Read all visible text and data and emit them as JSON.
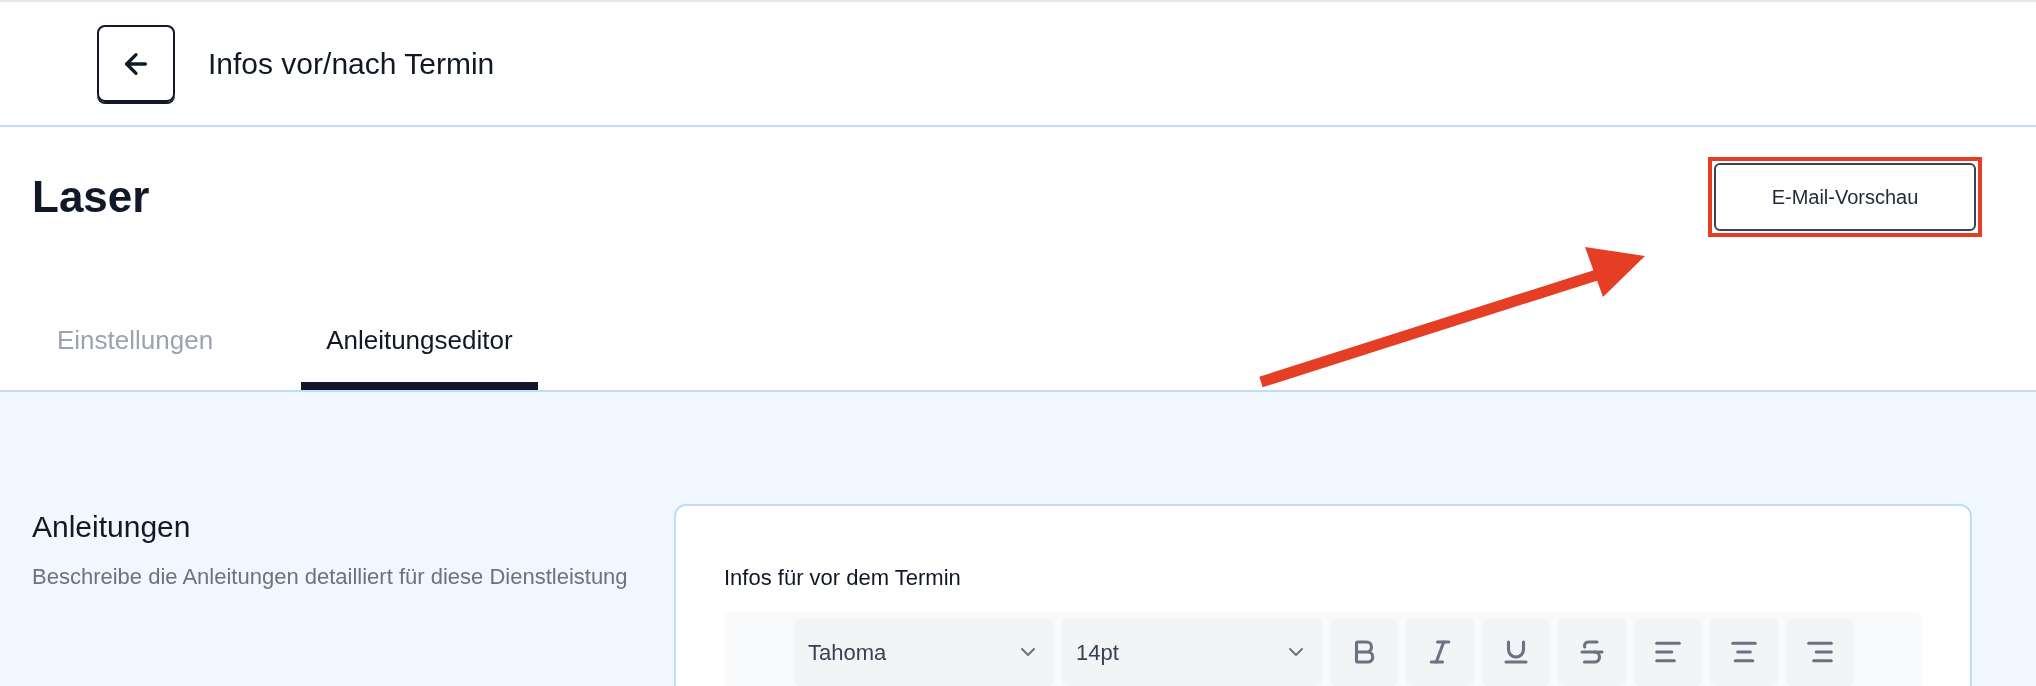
{
  "header": {
    "title": "Infos vor/nach Termin"
  },
  "page": {
    "title": "Laser",
    "preview_button": {
      "label": "E-Mail-Vorschau",
      "highlighted": true
    }
  },
  "tabs": [
    {
      "label": "Einstellungen",
      "selected": false
    },
    {
      "label": "Anleitungseditor",
      "selected": true
    }
  ],
  "section": {
    "heading": "Anleitungen",
    "description": "Beschreibe die Anleitungen detailliert für diese Dienstleistung"
  },
  "editor": {
    "label": "Infos für vor dem Termin",
    "font": "Tahoma",
    "size": "14pt",
    "format_buttons": [
      {
        "kind": "bold"
      },
      {
        "kind": "italic"
      },
      {
        "kind": "underline"
      },
      {
        "kind": "strikethrough"
      },
      {
        "kind": "align-left"
      },
      {
        "kind": "align-center"
      },
      {
        "kind": "align-right"
      }
    ]
  }
}
